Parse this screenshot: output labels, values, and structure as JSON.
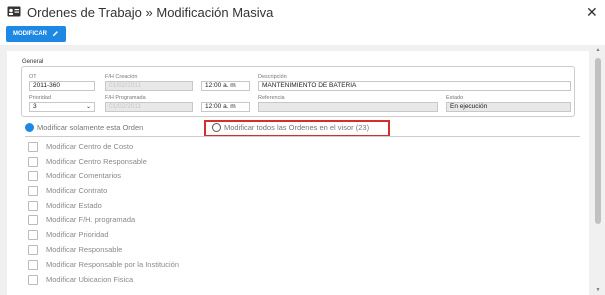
{
  "window": {
    "title": "Ordenes de Trabajo » Modificación Masiva",
    "close_icon": "close-icon"
  },
  "toolbar": {
    "modificar_label": "MODIFICAR",
    "modificar_icon": "pencil-icon",
    "button_color": "#1e88e5"
  },
  "general": {
    "section_label": "General",
    "ot_label": "OT",
    "ot_value": "2011-360",
    "creacion_label": "F/H Creación",
    "creacion_date": "01/02/2011",
    "creacion_time": "12:00 a. m",
    "descripcion_label": "Descripción",
    "descripcion_value": "MANTENIMIENTO DE BATERIA",
    "prioridad_label": "Prioridad",
    "prioridad_value": "3",
    "programada_label": "F/H Programada",
    "programada_date": "01/02/2011",
    "programada_time": "12:00 a. m",
    "referencia_label": "Referencia",
    "referencia_value": "",
    "estado_label": "Estado",
    "estado_value": "En ejecución"
  },
  "scope": {
    "option_single": "Modificar solamente esta Orden",
    "option_all": "Modificar todos las Ordenes en el visor (23)",
    "selected": "single",
    "highlight_color": "#d32f2f"
  },
  "fields": [
    "Modificar Centro de Costo",
    "Modificar Centro Responsable",
    "Modificar Comentarios",
    "Modificar Contrato",
    "Modificar Estado",
    "Modificar F/H. programada",
    "Modificar Prioridad",
    "Modificar Responsable",
    "Modificar Responsable por la Institución",
    "Modificar Ubicacion Fisica"
  ]
}
